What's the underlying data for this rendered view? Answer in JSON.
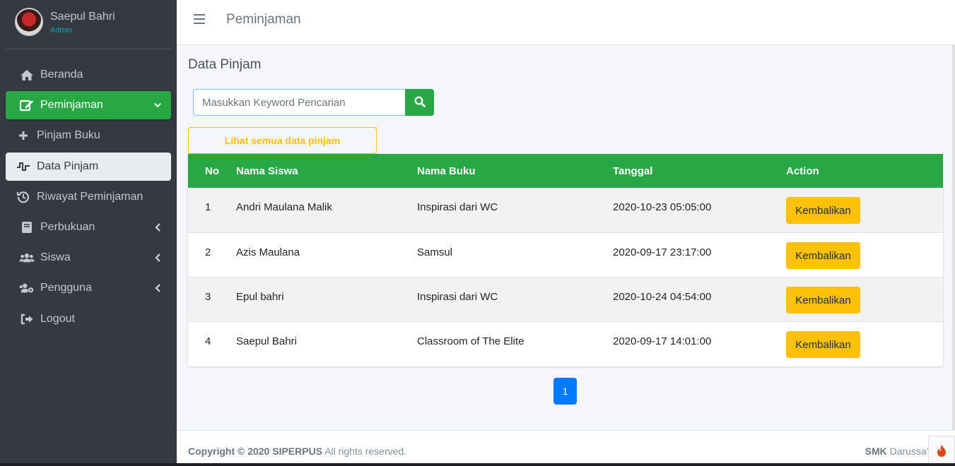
{
  "user": {
    "name": "Saepul Bahri",
    "role": "Admin"
  },
  "sidebar": {
    "items": [
      {
        "label": "Beranda",
        "icon": "home-icon"
      },
      {
        "label": "Peminjaman",
        "icon": "edit-icon",
        "active": true
      },
      {
        "label": "Pinjam Buku",
        "icon": "plus-icon"
      },
      {
        "label": "Data Pinjam",
        "icon": "pulse-icon",
        "active": true
      },
      {
        "label": "Riwayat Peminjaman",
        "icon": "history-icon"
      },
      {
        "label": "Perbukuan",
        "icon": "book-icon"
      },
      {
        "label": "Siswa",
        "icon": "users-icon"
      },
      {
        "label": "Pengguna",
        "icon": "users-cog-icon"
      },
      {
        "label": "Logout",
        "icon": "sign-out-icon"
      }
    ]
  },
  "header": {
    "title": "Peminjaman"
  },
  "main": {
    "title": "Data Pinjam",
    "search_placeholder": "Masukkan Keyword Pencarian",
    "show_all_label": "Lihat semua data pinjam",
    "table": {
      "headers": [
        "No",
        "Nama Siswa",
        "Nama Buku",
        "Tanggal",
        "Action"
      ],
      "rows": [
        {
          "no": "1",
          "nama": "Andri Maulana Malik",
          "buku": "Inspirasi dari WC",
          "tanggal": "2020-10-23 05:05:00",
          "action": "Kembalikan"
        },
        {
          "no": "2",
          "nama": "Azis Maulana",
          "buku": "Samsul",
          "tanggal": "2020-09-17 23:17:00",
          "action": "Kembalikan"
        },
        {
          "no": "3",
          "nama": "Epul bahri",
          "buku": "Inspirasi dari WC",
          "tanggal": "2020-10-24 04:54:00",
          "action": "Kembalikan"
        },
        {
          "no": "4",
          "nama": "Saepul Bahri",
          "buku": "Classroom of The Elite",
          "tanggal": "2020-09-17 14:01:00",
          "action": "Kembalikan"
        }
      ]
    },
    "pagination": {
      "current": "1"
    }
  },
  "footer": {
    "copyright_bold": "Copyright © 2020 SIPERPUS",
    "copyright_rest": " All rights reserved.",
    "right_bold": "SMK",
    "right_rest": " Darussa'ad"
  },
  "colors": {
    "accent": "#28a745",
    "warning": "#ffc107",
    "primary": "#007bff",
    "sidebar": "#343a40"
  }
}
